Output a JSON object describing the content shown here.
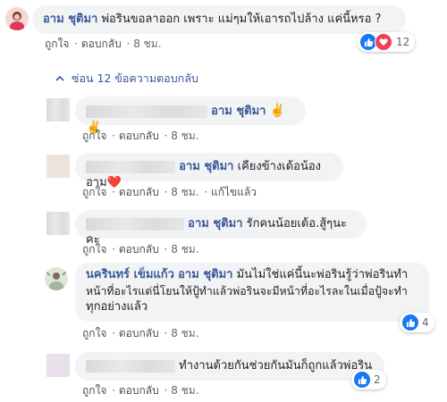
{
  "top_comment": {
    "author": "อาม ชุติมา",
    "text": "พ่อรินขอลาออก เพราะ แม่ๆมให้เอารถไปล้าง แค่นี้หรอ ?",
    "like": "ถูกใจ",
    "reply": "ตอบกลับ",
    "time": "8 ชม.",
    "reaction_count": "12"
  },
  "hide_replies": "ซ่อน 12 ข้อความตอบกลับ",
  "replies": [
    {
      "mention": "อาม ชุติมา",
      "text": "✌️✌️",
      "like": "ถูกใจ",
      "reply": "ตอบกลับ",
      "time": "8 ชม."
    },
    {
      "mention": "อาม ชุติมา",
      "text": "เคียงข้างเด้อน้องอาม",
      "emoji": "❤️",
      "like": "ถูกใจ",
      "reply": "ตอบกลับ",
      "time": "8 ชม.",
      "edited": "แก้ไขแล้ว"
    },
    {
      "mention": "อาม ชุติมา",
      "text": "รักคนน้อยเด้อ.สู้ๆนะคะ",
      "like": "ถูกใจ",
      "reply": "ตอบกลับ",
      "time": "8 ชม."
    },
    {
      "author": "นครินทร์ เข็มแก้ว",
      "mention": "อาม ชุติมา",
      "line1": "มันไม่ใช่แค่นี้นะพ่อรินรู้ว่าพ่อรินทำ",
      "line2": "หน้าที่อะไรแต่นี่โยนให้ปู้ทำแล้วพ่อรินจะมีหน้าที่อะไรละในเมื่อปู้จะทำ",
      "line3": "ทุกอย่างแล้ว",
      "like": "ถูกใจ",
      "reply": "ตอบกลับ",
      "time": "8 ชม.",
      "reaction_count": "4"
    },
    {
      "text": "ทำงานด้วยกันช่วยกันมันก็ถูกแล้วพ่อริน",
      "like": "ถูกใจ",
      "reply": "ตอบกลับ",
      "time": "8 ชม.",
      "reaction_count": "2"
    }
  ],
  "colors": {
    "name": "#385898",
    "bubble": "#f2f3f5",
    "like_blue": "#1877f2",
    "love_red": "#f33e58"
  }
}
